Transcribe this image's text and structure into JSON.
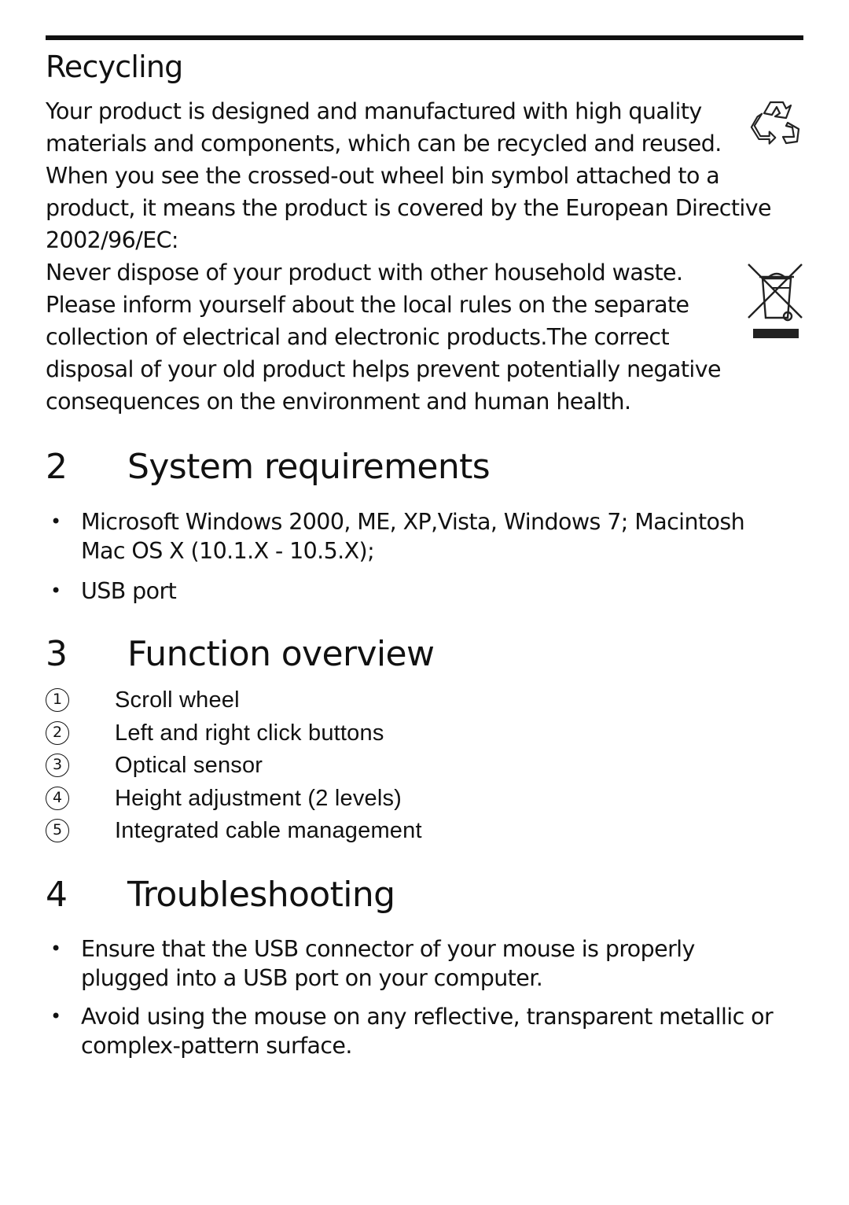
{
  "recycling": {
    "title": "Recycling",
    "paragraph1_lines": [
      "Your product is designed and manufactured with high quality",
      "materials and components, which can be recycled and reused.",
      "When you see the crossed-out wheel bin symbol attached to a",
      "product, it means the product is covered by the European Directive",
      "2002/96/EC:"
    ],
    "paragraph2_lines": [
      "Never dispose of your product with other household waste.",
      "Please inform yourself about the local rules on the separate",
      "collection of electrical and electronic products.The correct",
      "disposal of your old product helps prevent potentially negative",
      "consequences on the environment and human health."
    ],
    "icons": [
      "recycle-icon",
      "crossed-out-wheel-bin-icon"
    ]
  },
  "system_requirements": {
    "number": "2",
    "title": "System requirements",
    "items": [
      {
        "lines": [
          "Microsoft Windows 2000, ME, XP,Vista, Windows 7; Macintosh",
          "Mac OS X (10.1.X - 10.5.X);"
        ]
      },
      {
        "lines": [
          "USB port"
        ]
      }
    ]
  },
  "function_overview": {
    "number": "3",
    "title": "Function overview",
    "items": [
      {
        "num": "1",
        "label": "Scroll wheel"
      },
      {
        "num": "2",
        "label": "Left and right click buttons"
      },
      {
        "num": "3",
        "label": "Optical sensor"
      },
      {
        "num": "4",
        "label": "Height adjustment (2 levels)"
      },
      {
        "num": "5",
        "label": "Integrated cable management"
      }
    ]
  },
  "troubleshooting": {
    "number": "4",
    "title": "Troubleshooting",
    "items": [
      {
        "lines": [
          "Ensure that the USB connector of your mouse is properly",
          "plugged into a USB port on your computer."
        ]
      },
      {
        "lines": [
          "Avoid using the mouse on any reflective, transparent metallic or",
          "complex-pattern surface."
        ]
      }
    ]
  },
  "bullet_glyph": "•"
}
